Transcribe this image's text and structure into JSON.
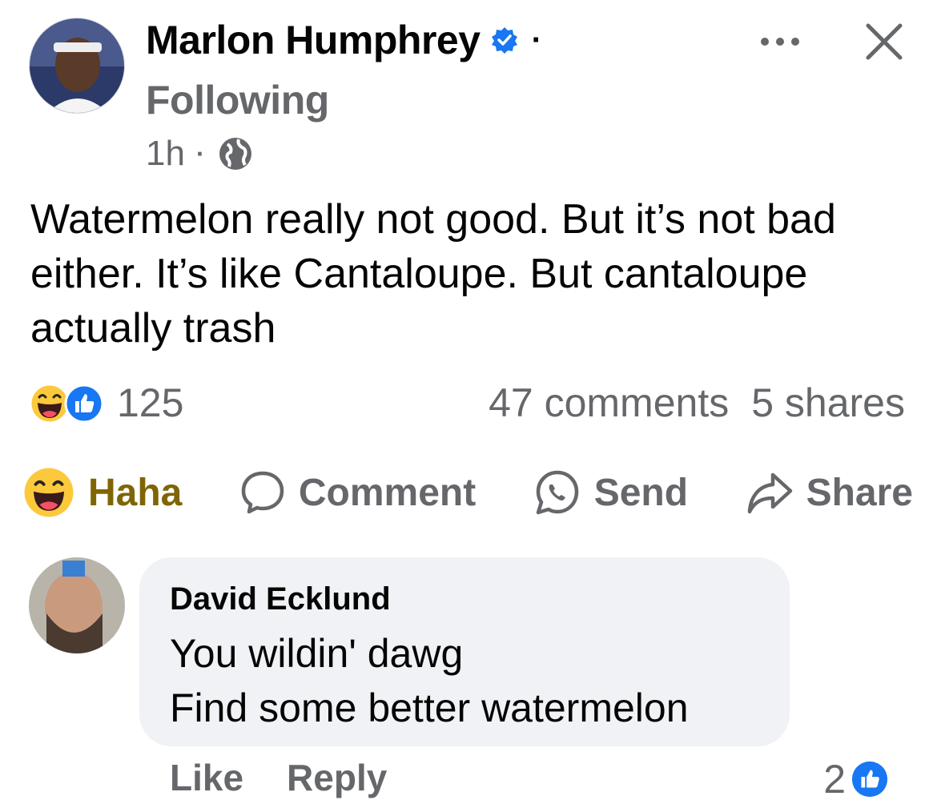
{
  "post": {
    "author": "Marlon Humphrey",
    "separator_dot": "·",
    "follow_status": "Following",
    "time": "1h",
    "meta_dot": "·",
    "text": "Watermelon really not good. But it’s not bad either. It’s like Cantaloupe. But cantaloupe actually trash",
    "more_icon": "more-horizontal-icon",
    "close_icon": "close-icon",
    "privacy_icon": "globe-icon"
  },
  "stats": {
    "reactions": [
      "haha",
      "like"
    ],
    "reaction_count": "125",
    "comments": "47 comments",
    "shares": "5 shares"
  },
  "actions": {
    "haha": "Haha",
    "comment": "Comment",
    "send": "Send",
    "share": "Share"
  },
  "comment": {
    "author": "David Ecklund",
    "line1": "You wildin' dawg",
    "line2": "Find some better watermelon",
    "like_label": "Like",
    "reply_label": "Reply",
    "like_count": "2"
  },
  "colors": {
    "facebook_blue": "#1877f2",
    "secondary_text": "#65676b",
    "haha_text": "#7f6504",
    "bubble_bg": "#f0f2f5"
  }
}
